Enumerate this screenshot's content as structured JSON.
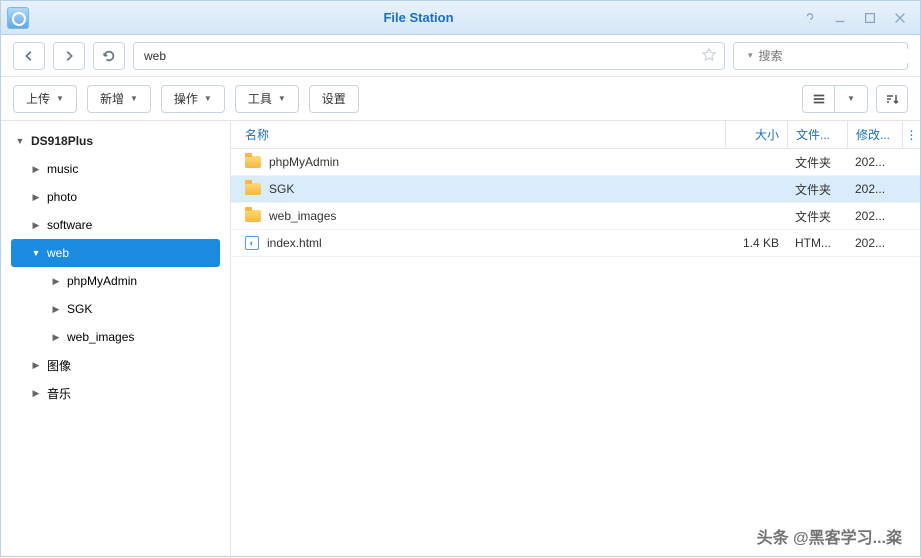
{
  "window": {
    "title": "File Station"
  },
  "nav": {
    "path": "web",
    "search_placeholder": "搜索"
  },
  "toolbar": {
    "upload": "上传",
    "create": "新增",
    "action": "操作",
    "tools": "工具",
    "settings": "设置"
  },
  "sidebar": {
    "root": "DS918Plus",
    "items": [
      {
        "label": "music",
        "indent": 1,
        "expanded": false
      },
      {
        "label": "photo",
        "indent": 1,
        "expanded": false
      },
      {
        "label": "software",
        "indent": 1,
        "expanded": false
      },
      {
        "label": "web",
        "indent": 1,
        "expanded": true,
        "selected": true
      },
      {
        "label": "phpMyAdmin",
        "indent": 2,
        "expanded": false
      },
      {
        "label": "SGK",
        "indent": 2,
        "expanded": false
      },
      {
        "label": "web_images",
        "indent": 2,
        "expanded": false
      },
      {
        "label": "图像",
        "indent": 1,
        "expanded": false
      },
      {
        "label": "音乐",
        "indent": 1,
        "expanded": false
      }
    ]
  },
  "grid": {
    "headers": {
      "name": "名称",
      "size": "大小",
      "type": "文件...",
      "date": "修改..."
    },
    "rows": [
      {
        "icon": "folder",
        "name": "phpMyAdmin",
        "size": "",
        "type": "文件夹",
        "date": "202...",
        "selected": false
      },
      {
        "icon": "folder",
        "name": "SGK",
        "size": "",
        "type": "文件夹",
        "date": "202...",
        "selected": true
      },
      {
        "icon": "folder",
        "name": "web_images",
        "size": "",
        "type": "文件夹",
        "date": "202...",
        "selected": false
      },
      {
        "icon": "html",
        "name": "index.html",
        "size": "1.4 KB",
        "type": "HTM...",
        "date": "202...",
        "selected": false
      }
    ]
  },
  "watermark": "头条 @黑客学习...粢"
}
